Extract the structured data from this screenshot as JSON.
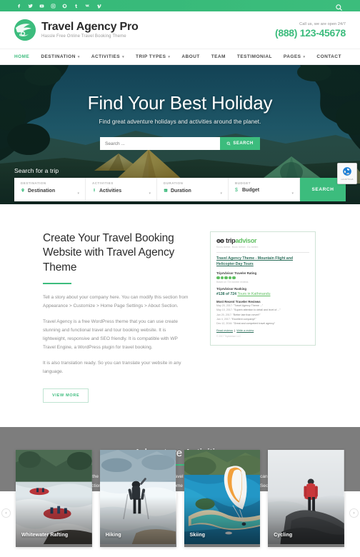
{
  "topbar": {
    "social_icons": [
      {
        "name": "facebook-icon",
        "glyph": "f"
      },
      {
        "name": "twitter-icon",
        "glyph": "t"
      },
      {
        "name": "youtube-icon",
        "glyph": "y"
      },
      {
        "name": "instagram-icon",
        "glyph": "i"
      },
      {
        "name": "pinterest-icon",
        "glyph": "p"
      },
      {
        "name": "tumblr-icon",
        "glyph": "u"
      },
      {
        "name": "vk-icon",
        "glyph": "v"
      },
      {
        "name": "vimeo-icon",
        "glyph": "m"
      }
    ],
    "search_toggle": "search-icon",
    "background_color": "#3cbc7d"
  },
  "header": {
    "brand_name": "Travel Agency Pro",
    "brand_tagline": "Hassle Free Online Travel Booking Theme",
    "call_note": "Call us, we are open 24/7",
    "phone": "(888) 123-45678",
    "accent_color": "#3cbc7d"
  },
  "nav": {
    "items": [
      {
        "label": "HOME",
        "has_dropdown": false,
        "active": true
      },
      {
        "label": "DESTINATION",
        "has_dropdown": true,
        "active": false
      },
      {
        "label": "ACTIVITIES",
        "has_dropdown": true,
        "active": false
      },
      {
        "label": "TRIP TYPES",
        "has_dropdown": true,
        "active": false
      },
      {
        "label": "ABOUT",
        "has_dropdown": false,
        "active": false
      },
      {
        "label": "TEAM",
        "has_dropdown": false,
        "active": false
      },
      {
        "label": "TESTIMONIAL",
        "has_dropdown": false,
        "active": false
      },
      {
        "label": "PAGES",
        "has_dropdown": true,
        "active": false
      },
      {
        "label": "CONTACT",
        "has_dropdown": false,
        "active": false
      }
    ]
  },
  "hero": {
    "title": "Find Your Best Holiday",
    "subtitle": "Find great adventure holidays and activities around the planet.",
    "search_placeholder": "Search ...",
    "search_value": "",
    "search_button": "SEARCH"
  },
  "recaptcha": {
    "label": "reCAPTCHA"
  },
  "trip_search": {
    "title": "Search for a trip",
    "fields": [
      {
        "label": "DESTINATION",
        "value": "Destination",
        "icon": "map-pin-icon"
      },
      {
        "label": "ACTIVITIES",
        "value": "Activities",
        "icon": "person-icon"
      },
      {
        "label": "DURATION",
        "value": "Duration",
        "icon": "calendar-icon"
      },
      {
        "label": "BUDGET",
        "value": "Budget",
        "icon": "dollar-icon"
      }
    ],
    "button": "SEARCH"
  },
  "about": {
    "title": "Create Your Travel Booking Website with Travel Agency Theme",
    "paragraphs": [
      "Tell a story about your company here. You can modify this section from Appearance > Customize > Home Page Settings > About Section.",
      "Travel Agency is a free WordPress theme that you can use create stunning and functional travel and tour booking website. It is lightweight, responsive and SEO friendly. It is compatible with WP Travel Engine, a WordPress plugin for travel booking.",
      "It is also translation ready. So you can translate your website in any language."
    ],
    "view_more": "VIEW MORE"
  },
  "tripadvisor": {
    "logo_text_1": "trip",
    "logo_text_2": "advisor",
    "logo_sub": "Know better. Book better. Go better.",
    "title": "Travel Agency Theme - Mountain Flight and Helicopter Day Tours",
    "rating_label": "TripAdvisor Traveler Rating",
    "bubbles": 5,
    "rating_note": "Based on 724 traveler reviews",
    "ranking_label": "TripAdvisor Ranking",
    "ranking_value": "#138 of 724",
    "ranking_link": "Tours in Kathmandu",
    "reviews_heading": "Most Recent Traveler Reviews",
    "reviews": [
      {
        "date": "May 20, 2017:",
        "text": "\"Travel Agency Theme ...\""
      },
      {
        "date": "May 10, 2017:",
        "text": "\"Superb attention to detail and level of ...\""
      },
      {
        "date": "Jan 20, 2017:",
        "text": "\"Better late than never!!\""
      },
      {
        "date": "Jan 4, 2017:",
        "text": "\"Excellent company!!\""
      },
      {
        "date": "Dec 12, 2016:",
        "text": "\"Great and competent travel agency\""
      }
    ],
    "read_reviews": "Read reviews",
    "write_review": "Write a review",
    "copyright": "© 2017 TripAdvisor LLC"
  },
  "adventure": {
    "title": "Adventure Activities",
    "description": "This is the best place to tell your visitors what travel services your company provide. You can modify this section from Appearance > Customize > Home Page Settings > Adventure Activities Section on your WordPress.",
    "background_color": "#7d7d7d"
  },
  "cards": [
    {
      "label": "Whitewater Rafting"
    },
    {
      "label": "Hiking"
    },
    {
      "label": "Skiing"
    },
    {
      "label": "Cycling"
    }
  ],
  "carousel": {
    "prev": "‹",
    "next": "›"
  }
}
